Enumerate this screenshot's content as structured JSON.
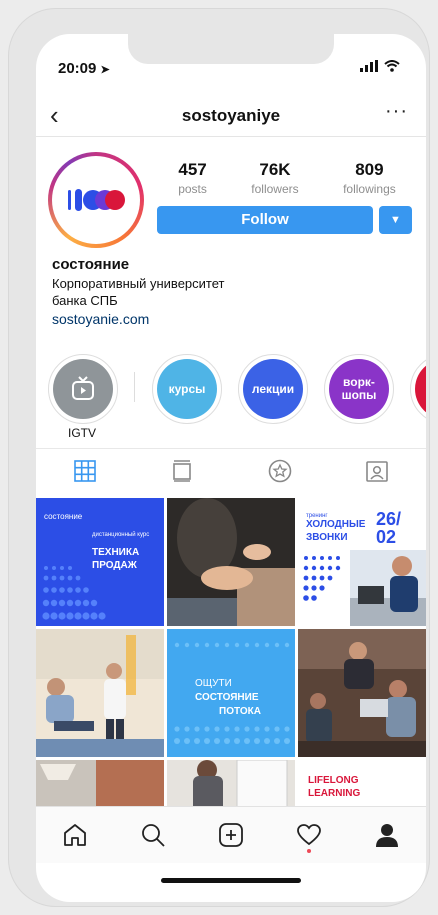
{
  "status": {
    "time": "20:09"
  },
  "nav": {
    "back": "‹",
    "username": "sostoyaniye",
    "more": "···"
  },
  "stats": [
    {
      "num": "457",
      "label": "posts"
    },
    {
      "num": "76K",
      "label": "followers"
    },
    {
      "num": "809",
      "label": "followings"
    }
  ],
  "follow": {
    "label": "Follow",
    "dropdown": "▼"
  },
  "bio": {
    "name": "состояние",
    "line1": "Корпоративный университет",
    "line2": "банка СПБ",
    "link": "sostoyanie.com"
  },
  "highlights": [
    {
      "label": "IGTV",
      "inner": "",
      "color": "#9aa0a4"
    },
    {
      "label": "",
      "inner": "курсы",
      "color": "#4fb4e6"
    },
    {
      "label": "",
      "inner": "лекции",
      "color": "#3b62e6"
    },
    {
      "label": "",
      "inner": "ворк-шопы",
      "color": "#8a34c8"
    },
    {
      "label": "",
      "inner": "",
      "color": "#d9163a"
    }
  ],
  "posts": {
    "p1": {
      "brand": "состояние",
      "small": "дистанционный курс",
      "title": "ТЕХНИКА ПРОДАЖ"
    },
    "p3": {
      "small": "тренинг",
      "title": "ХОЛОДНЫЕ ЗВОНКИ",
      "date": "26/ 02"
    },
    "p5": {
      "line1": "ОЩУТИ",
      "line2": "СОСТОЯНИЕ",
      "line3": "ПОТОКА"
    },
    "p9": {
      "title": "LIFELONG LEARNING"
    }
  },
  "colors": {
    "accent": "#3897f0",
    "brand_blue": "#2c4ee6",
    "notification": "#ed4956"
  }
}
